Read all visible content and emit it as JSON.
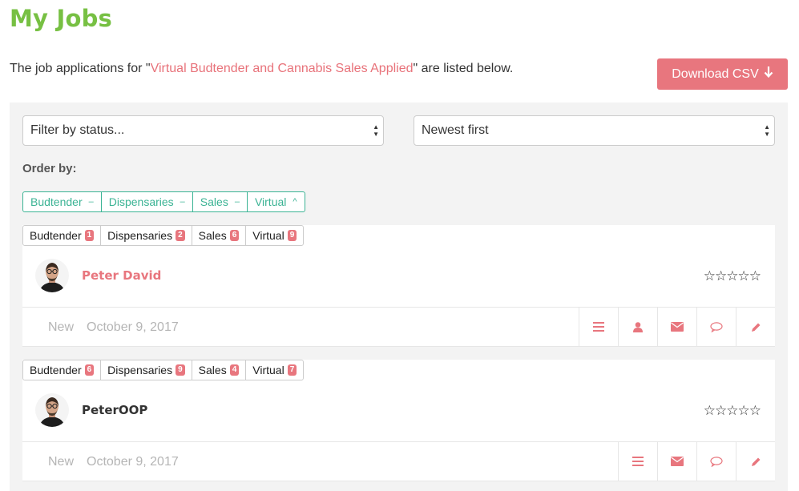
{
  "page": {
    "title": "My Jobs",
    "intro_prefix": "The job applications for \"",
    "intro_job": "Virtual Budtender and Cannabis Sales Applied",
    "intro_suffix": "\" are listed below.",
    "csv_button": "Download CSV"
  },
  "filters": {
    "status_select": "Filter by status...",
    "sort_select": "Newest first"
  },
  "order": {
    "label": "Order by:",
    "buttons": [
      {
        "label": "Budtender",
        "dir": "–"
      },
      {
        "label": "Dispensaries",
        "dir": "–"
      },
      {
        "label": "Sales",
        "dir": "–"
      },
      {
        "label": "Virtual",
        "dir": "^"
      }
    ]
  },
  "applicants": [
    {
      "name": "Peter David",
      "tags": [
        {
          "label": "Budtender",
          "count": "1"
        },
        {
          "label": "Dispensaries",
          "count": "2"
        },
        {
          "label": "Sales",
          "count": "6"
        },
        {
          "label": "Virtual",
          "count": "9"
        }
      ],
      "rating": "☆☆☆☆☆",
      "status": "New",
      "date": "October 9, 2017"
    },
    {
      "name": "PeterOOP",
      "tags": [
        {
          "label": "Budtender",
          "count": "6"
        },
        {
          "label": "Dispensaries",
          "count": "9"
        },
        {
          "label": "Sales",
          "count": "4"
        },
        {
          "label": "Virtual",
          "count": "7"
        }
      ],
      "rating": "☆☆☆☆☆",
      "status": "New",
      "date": "October 9, 2017"
    }
  ],
  "colors": {
    "title_green": "#77c043",
    "accent_pink": "#e8767e",
    "teal": "#3bb394",
    "panel_bg": "#f3f3f3"
  }
}
